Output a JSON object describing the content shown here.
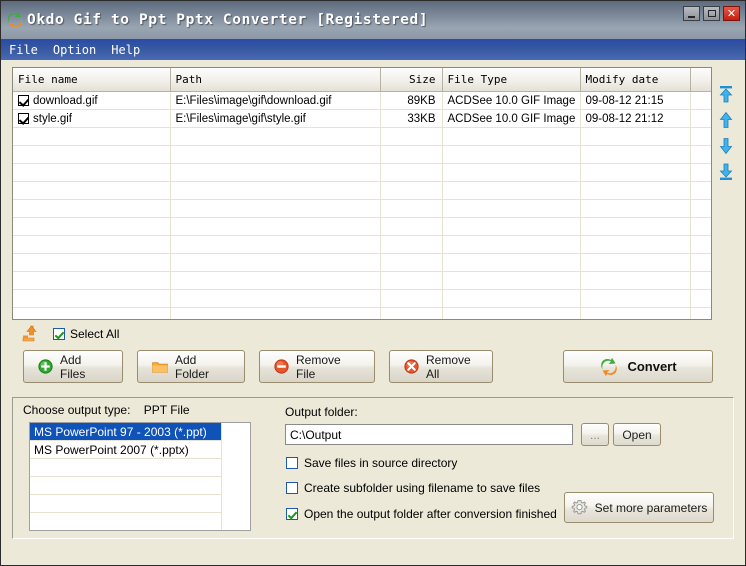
{
  "window": {
    "title": "Okdo Gif to Ppt Pptx Converter  [Registered]",
    "app_icon": "swirl-icon",
    "controls": {
      "minimize": "minimize-button",
      "maximize": "maximize-button",
      "close": "close-button",
      "close_glyph": "✕"
    }
  },
  "menubar": {
    "items": [
      {
        "label": "File"
      },
      {
        "label": "Option"
      },
      {
        "label": "Help"
      }
    ]
  },
  "filelist": {
    "columns": [
      "File name",
      "Path",
      "Size",
      "File Type",
      "Modify date",
      ""
    ],
    "rows": [
      {
        "checked": true,
        "name": "download.gif",
        "path": "E:\\Files\\image\\gif\\download.gif",
        "size": "89KB",
        "type": "ACDSee 10.0 GIF Image",
        "modified": "09-08-12 21:15"
      },
      {
        "checked": true,
        "name": "style.gif",
        "path": "E:\\Files\\image\\gif\\style.gif",
        "size": "33KB",
        "type": "ACDSee 10.0 GIF Image",
        "modified": "09-08-12 21:12"
      }
    ],
    "empty_row_count": 11
  },
  "order_buttons": [
    {
      "name": "move-to-top-button"
    },
    {
      "name": "move-up-button"
    },
    {
      "name": "move-down-button"
    },
    {
      "name": "move-to-bottom-button"
    }
  ],
  "select_all": {
    "icon": "up-folder-icon",
    "label": "Select All",
    "checked": true
  },
  "toolbar": {
    "add_files": "Add Files",
    "add_folder": "Add Folder",
    "remove_file": "Remove File",
    "remove_all": "Remove All",
    "convert": "Convert"
  },
  "output": {
    "choose_type_label": "Choose output type:",
    "choose_type_value": "PPT File",
    "types": [
      {
        "label": "MS PowerPoint 97 - 2003 (*.ppt)",
        "selected": true
      },
      {
        "label": "MS PowerPoint 2007 (*.pptx)",
        "selected": false
      }
    ],
    "folder_label": "Output folder:",
    "folder_value": "C:\\Output",
    "browse_label": "...",
    "open_label": "Open",
    "options": [
      {
        "label": "Save files in source directory",
        "checked": false
      },
      {
        "label": "Create subfolder using filename to save files",
        "checked": false
      },
      {
        "label": "Open the output folder after conversion finished",
        "checked": true
      }
    ],
    "params_button": "Set more parameters"
  },
  "colors": {
    "titlebar_top": "#5d6b7d",
    "menubar": "#36589f",
    "selection_blue": "#1053b8",
    "accent_orange": "#f08a24",
    "accent_green": "#3faa3f",
    "close_red": "#c21f10",
    "face": "#ece9d8"
  }
}
